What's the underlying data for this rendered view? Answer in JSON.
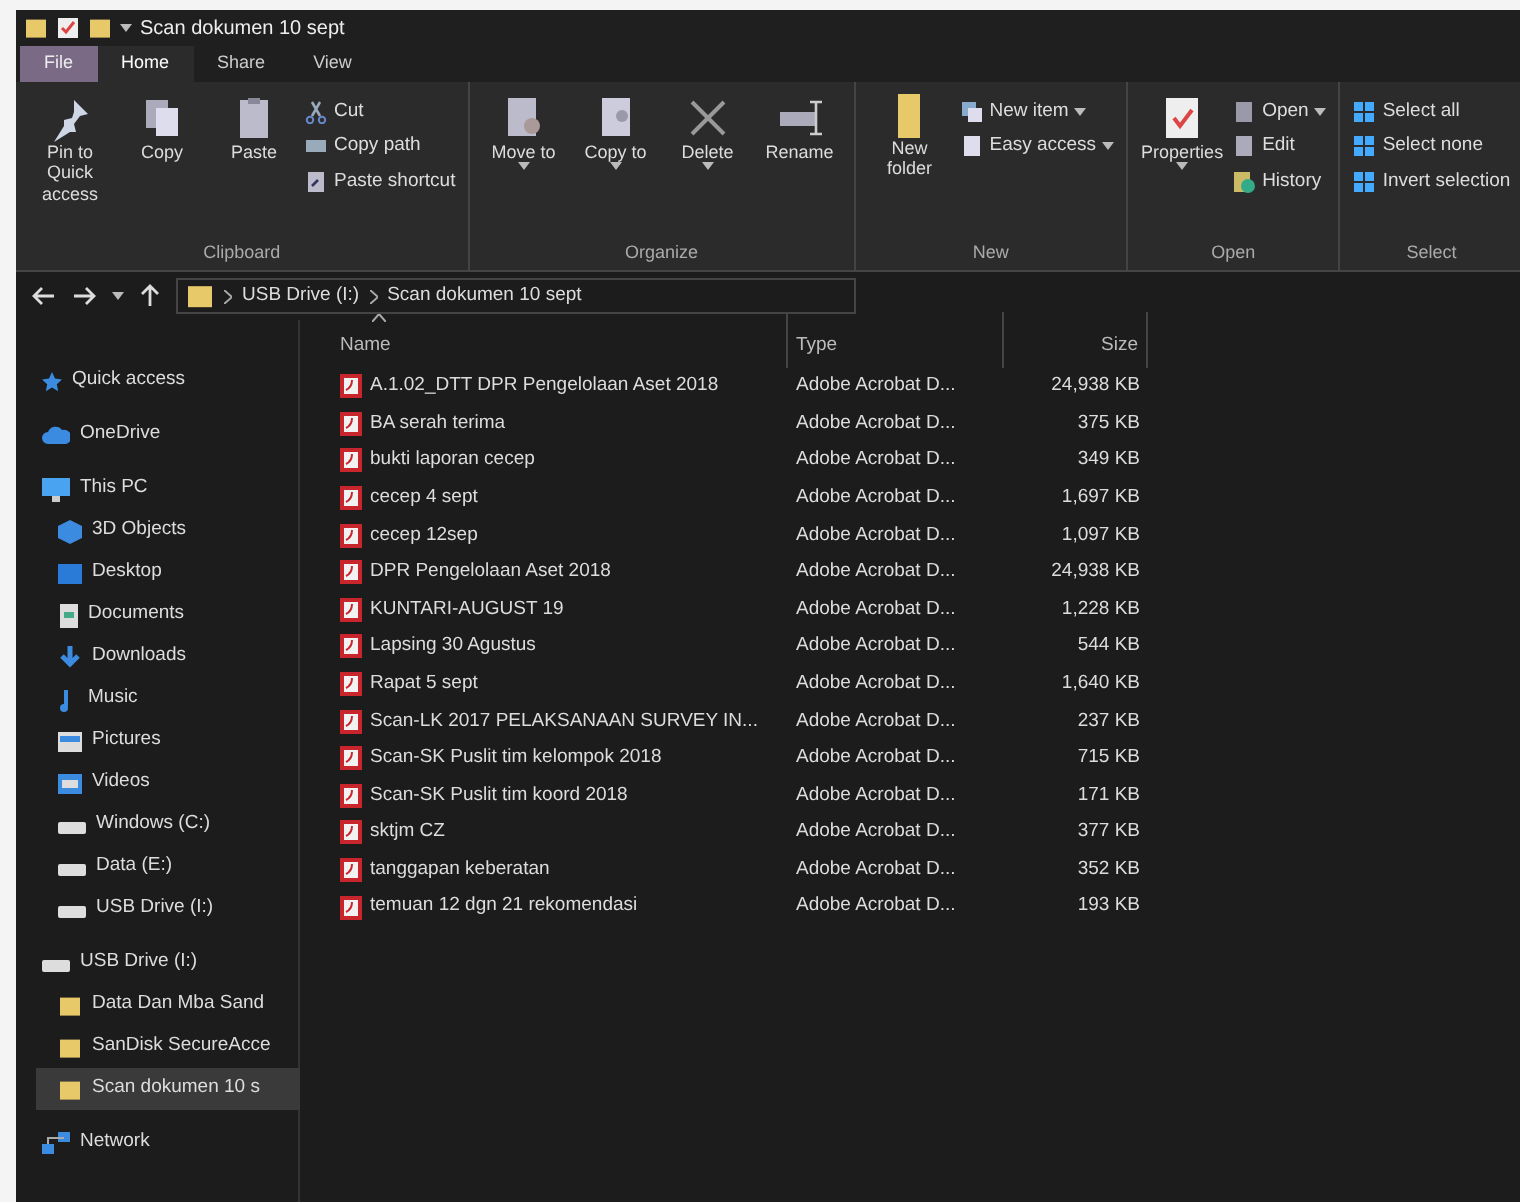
{
  "window": {
    "title": "Scan dokumen 10 sept"
  },
  "tabs": [
    {
      "label": "File",
      "selected": false,
      "kind": "file"
    },
    {
      "label": "Home",
      "selected": true,
      "kind": "tab"
    },
    {
      "label": "Share",
      "selected": false,
      "kind": "tab"
    },
    {
      "label": "View",
      "selected": false,
      "kind": "tab"
    }
  ],
  "ribbon": [
    {
      "label": "Clipboard",
      "buttons": [
        {
          "label": "Pin to Quick access",
          "kind": "large",
          "dropdown": false
        },
        {
          "label": "Copy",
          "kind": "large",
          "dropdown": false
        },
        {
          "label": "Paste",
          "kind": "large",
          "dropdown": false
        },
        {
          "label": "Cut",
          "kind": "small",
          "dropdown": false
        },
        {
          "label": "Copy path",
          "kind": "small",
          "dropdown": false
        },
        {
          "label": "Paste shortcut",
          "kind": "small",
          "dropdown": false
        }
      ]
    },
    {
      "label": "Organize",
      "buttons": [
        {
          "label": "Move to",
          "kind": "large",
          "dropdown": true
        },
        {
          "label": "Copy to",
          "kind": "large",
          "dropdown": true
        },
        {
          "label": "Delete",
          "kind": "large",
          "dropdown": true
        },
        {
          "label": "Rename",
          "kind": "large",
          "dropdown": false
        }
      ]
    },
    {
      "label": "New",
      "buttons": [
        {
          "label": "New folder",
          "kind": "large",
          "dropdown": false
        },
        {
          "label": "New item",
          "kind": "small",
          "dropdown": true
        },
        {
          "label": "Easy access",
          "kind": "small",
          "dropdown": true
        }
      ]
    },
    {
      "label": "Open",
      "buttons": [
        {
          "label": "Properties",
          "kind": "large",
          "dropdown": true
        },
        {
          "label": "Open",
          "kind": "small",
          "dropdown": true
        },
        {
          "label": "Edit",
          "kind": "small",
          "dropdown": false
        },
        {
          "label": "History",
          "kind": "small",
          "dropdown": false
        }
      ]
    },
    {
      "label": "Select",
      "buttons": [
        {
          "label": "Select all",
          "kind": "small",
          "dropdown": false
        },
        {
          "label": "Select none",
          "kind": "small",
          "dropdown": false
        },
        {
          "label": "Invert selection",
          "kind": "small",
          "dropdown": false
        }
      ]
    }
  ],
  "address_bar": {
    "path": [
      "USB Drive (I:)",
      "Scan dokumen 10 sept"
    ]
  },
  "navigation": [
    {
      "label": "Quick access",
      "selected": false
    },
    {
      "label": "OneDrive",
      "selected": false
    },
    {
      "label": "This PC",
      "selected": false,
      "children": [
        {
          "label": "3D Objects",
          "selected": false
        },
        {
          "label": "Desktop",
          "selected": false
        },
        {
          "label": "Documents",
          "selected": false
        },
        {
          "label": "Downloads",
          "selected": false
        },
        {
          "label": "Music",
          "selected": false
        },
        {
          "label": "Pictures",
          "selected": false
        },
        {
          "label": "Videos",
          "selected": false
        },
        {
          "label": "Windows (C:)",
          "selected": false
        },
        {
          "label": "Data (E:)",
          "selected": false
        },
        {
          "label": "USB Drive (I:)",
          "selected": false
        }
      ]
    },
    {
      "label": "USB Drive (I:)",
      "selected": false,
      "children": [
        {
          "label": "Data Dan Mba Sand",
          "selected": false
        },
        {
          "label": "SanDisk SecureAcce",
          "selected": false
        },
        {
          "label": "Scan dokumen 10 s",
          "selected": true
        }
      ]
    },
    {
      "label": "Network",
      "selected": false
    }
  ],
  "file_list": {
    "columns": [
      {
        "label": "Name",
        "sorted": true
      },
      {
        "label": "Type",
        "sorted": false
      },
      {
        "label": "Size",
        "sorted": false
      }
    ],
    "rows": [
      {
        "name": "A.1.02_DTT DPR Pengelolaan Aset 2018",
        "type": "Adobe Acrobat D...",
        "size": "24,938 KB"
      },
      {
        "name": "BA serah terima",
        "type": "Adobe Acrobat D...",
        "size": "375 KB"
      },
      {
        "name": "bukti laporan cecep",
        "type": "Adobe Acrobat D...",
        "size": "349 KB"
      },
      {
        "name": "cecep 4 sept",
        "type": "Adobe Acrobat D...",
        "size": "1,697 KB"
      },
      {
        "name": "cecep 12sep",
        "type": "Adobe Acrobat D...",
        "size": "1,097 KB"
      },
      {
        "name": "DPR Pengelolaan Aset 2018",
        "type": "Adobe Acrobat D...",
        "size": "24,938 KB"
      },
      {
        "name": "KUNTARI-AUGUST 19",
        "type": "Adobe Acrobat D...",
        "size": "1,228 KB"
      },
      {
        "name": "Lapsing 30 Agustus",
        "type": "Adobe Acrobat D...",
        "size": "544 KB"
      },
      {
        "name": "Rapat 5 sept",
        "type": "Adobe Acrobat D...",
        "size": "1,640 KB"
      },
      {
        "name": "Scan-LK 2017 PELAKSANAAN SURVEY IN...",
        "type": "Adobe Acrobat D...",
        "size": "237 KB"
      },
      {
        "name": "Scan-SK Puslit tim kelompok 2018",
        "type": "Adobe Acrobat D...",
        "size": "715 KB"
      },
      {
        "name": "Scan-SK Puslit tim koord 2018",
        "type": "Adobe Acrobat D...",
        "size": "171 KB"
      },
      {
        "name": "sktjm CZ",
        "type": "Adobe Acrobat D...",
        "size": "377 KB"
      },
      {
        "name": "tanggapan keberatan",
        "type": "Adobe Acrobat D...",
        "size": "352 KB"
      },
      {
        "name": "temuan 12 dgn 21 rekomendasi",
        "type": "Adobe Acrobat D...",
        "size": "193 KB"
      }
    ]
  }
}
